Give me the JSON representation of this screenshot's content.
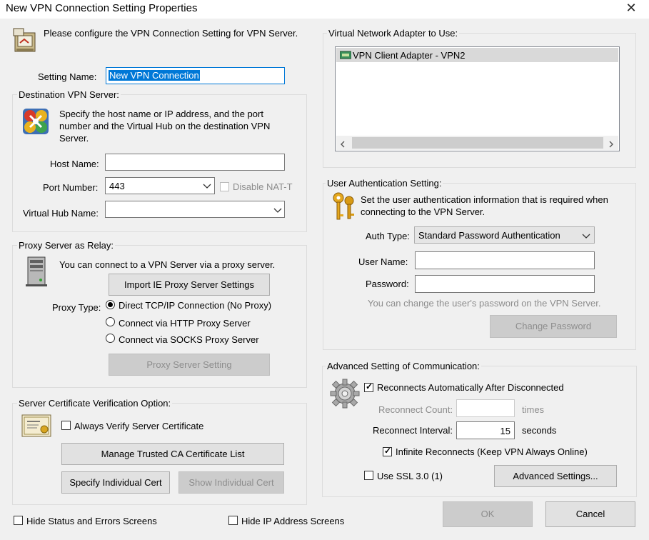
{
  "window": {
    "title": "New VPN Connection Setting Properties",
    "close_glyph": "✕"
  },
  "intro": "Please configure the VPN Connection Setting for VPN Server.",
  "setting_name": {
    "label": "Setting Name:",
    "value": "New VPN Connection"
  },
  "destination": {
    "group_label": "Destination VPN Server:",
    "description": "Specify the host name or IP address, and the port number and the Virtual Hub on the destination VPN Server.",
    "host_label": "Host Name:",
    "host_value": "",
    "port_label": "Port Number:",
    "port_value": "443",
    "disable_nat_label": "Disable NAT-T",
    "hub_label": "Virtual Hub Name:",
    "hub_value": ""
  },
  "proxy": {
    "group_label": "Proxy Server as Relay:",
    "description": "You can connect to a VPN Server via a proxy server.",
    "import_button": "Import IE Proxy Server Settings",
    "type_label": "Proxy Type:",
    "options": [
      "Direct TCP/IP Connection (No Proxy)",
      "Connect via HTTP Proxy Server",
      "Connect via SOCKS Proxy Server"
    ],
    "selected": "Direct TCP/IP Connection (No Proxy)",
    "setting_button": "Proxy Server Setting"
  },
  "certificate": {
    "group_label": "Server Certificate Verification Option:",
    "always_verify_label": "Always Verify Server Certificate",
    "always_verify_checked": false,
    "manage_button": "Manage Trusted CA Certificate List",
    "specify_button": "Specify Individual Cert",
    "show_button": "Show Individual Cert"
  },
  "adapter": {
    "group_label": "Virtual Network Adapter to Use:",
    "items": [
      "VPN Client Adapter - VPN2"
    ]
  },
  "auth": {
    "group_label": "User Authentication Setting:",
    "description": "Set the user authentication information that is required when connecting to the VPN Server.",
    "type_label": "Auth Type:",
    "type_value": "Standard Password Authentication",
    "user_label": "User Name:",
    "user_value": "",
    "password_label": "Password:",
    "password_value": "",
    "note": "You can change the user's password on the VPN Server.",
    "change_button": "Change Password"
  },
  "advanced": {
    "group_label": "Advanced Setting of Communication:",
    "reconnect_label": "Reconnects Automatically After Disconnected",
    "reconnect_checked": true,
    "count_label": "Reconnect Count:",
    "count_value": "",
    "count_unit": "times",
    "interval_label": "Reconnect Interval:",
    "interval_value": "15",
    "interval_unit": "seconds",
    "infinite_label": "Infinite Reconnects (Keep VPN Always Online)",
    "infinite_checked": true,
    "ssl_label": "Use SSL 3.0 (1)",
    "ssl_checked": false,
    "advanced_button": "Advanced Settings..."
  },
  "footer": {
    "hide_status_label": "Hide Status and Errors Screens",
    "hide_ip_label": "Hide IP Address Screens",
    "ok_button": "OK",
    "cancel_button": "Cancel"
  },
  "icons": {
    "computer": "computer-icon",
    "network": "network-icon",
    "server": "server-icon",
    "certificate": "certificate-icon",
    "keys": "keys-icon",
    "gear": "gear-icon"
  }
}
